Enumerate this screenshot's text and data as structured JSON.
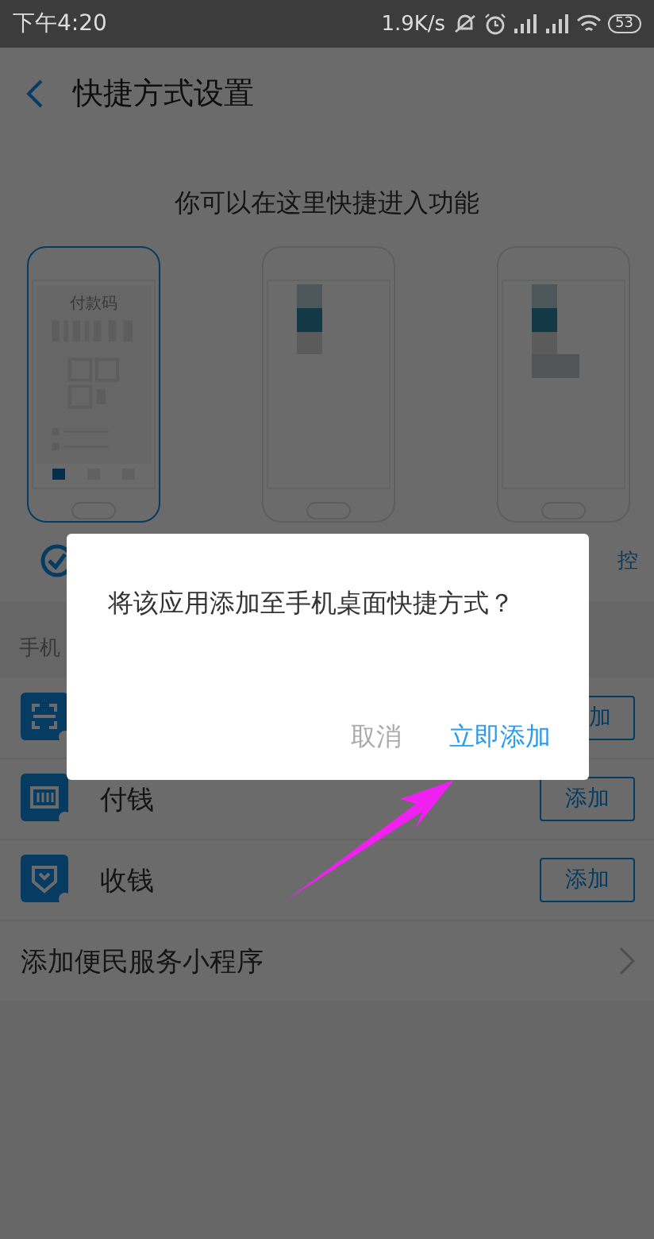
{
  "status_bar": {
    "time": "下午4:20",
    "speed": "1.9K/s",
    "battery": "53"
  },
  "header": {
    "title": "快捷方式设置"
  },
  "intro": "你可以在这里快捷进入功能",
  "phone_options": [
    {
      "selected": true,
      "screen_title": "付款码"
    },
    {
      "selected": false
    },
    {
      "selected": false,
      "label": "控"
    }
  ],
  "section_title": "手机",
  "shortcuts": [
    {
      "kind": "scan",
      "button": "加"
    },
    {
      "kind": "card",
      "name": "付钱",
      "button": "添加"
    },
    {
      "kind": "shield",
      "name": "收钱",
      "button": "添加"
    }
  ],
  "mini_program_link": "添加便民服务小程序",
  "dialog": {
    "message": "将该应用添加至手机桌面快捷方式？",
    "buttons": [
      {
        "kind": "cancel",
        "label": "取消"
      },
      {
        "kind": "confirm",
        "label": "立即添加"
      }
    ]
  }
}
